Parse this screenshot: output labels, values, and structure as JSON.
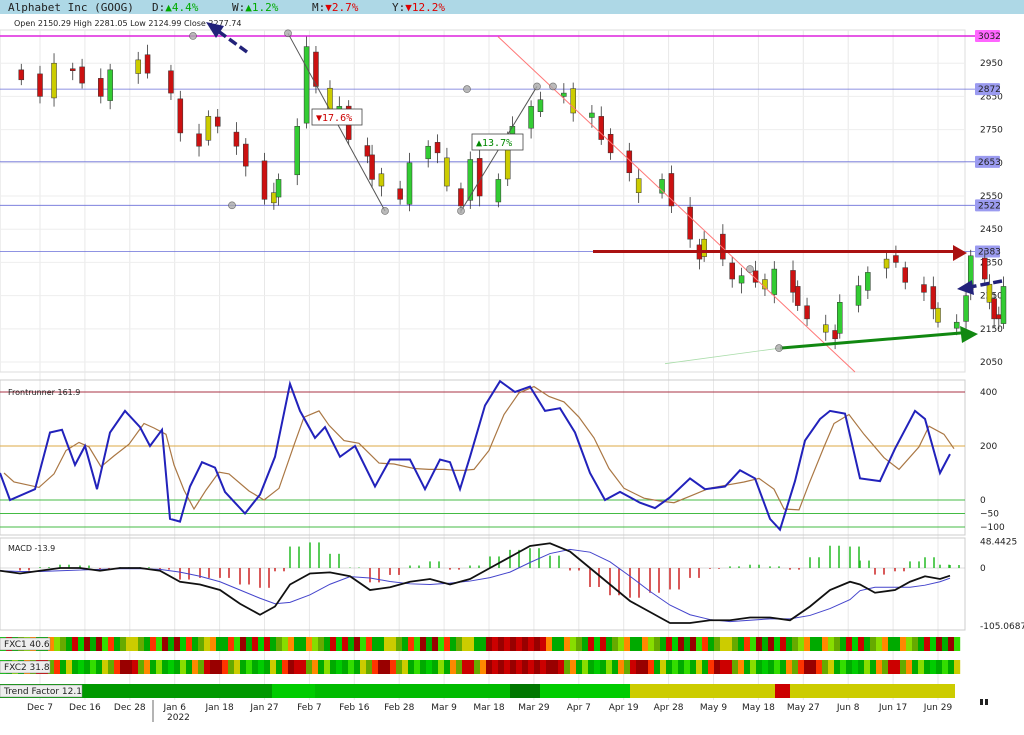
{
  "header": {
    "title": "Alphabet Inc (GOOG)",
    "changes": [
      {
        "label": "D:",
        "dir": "up",
        "value": "4.4%"
      },
      {
        "label": "W:",
        "dir": "up",
        "value": "1.2%"
      },
      {
        "label": "M:",
        "dir": "down",
        "value": "2.7%"
      },
      {
        "label": "Y:",
        "dir": "down",
        "value": "12.2%"
      }
    ],
    "ohlc": "Open 2150.29  High 2281.05  Low 2124.99  Close 2277.74"
  },
  "price_panel": {
    "y_ticks": [
      2050,
      2150,
      2250,
      2350,
      2450,
      2550,
      2650,
      2750,
      2850,
      2950
    ],
    "levels": [
      {
        "value": 3032,
        "label": "3032",
        "color": "#dd22dd"
      },
      {
        "value": 2872,
        "label": "2872",
        "color": "#6a6fd8"
      },
      {
        "value": 2653,
        "label": "2653",
        "color": "#6a6fd8"
      },
      {
        "value": 2522,
        "label": "2522",
        "color": "#6a6fd8"
      },
      {
        "value": 2383,
        "label": "2383",
        "color": "#6a6fd8"
      }
    ],
    "annotations": [
      {
        "text": "▼17.6%",
        "color": "#cc0000"
      },
      {
        "text": "▲13.7%",
        "color": "#008800"
      }
    ]
  },
  "frontrunner": {
    "label": "Frontrunner 161.9",
    "y_ticks": [
      "400",
      "200",
      "0",
      "−50",
      "−100"
    ]
  },
  "macd": {
    "label": "MACD -13.9",
    "y_ticks": [
      "48.4425",
      "0",
      "-105.0687"
    ]
  },
  "bands": [
    {
      "label": "FXC1 40.6"
    },
    {
      "label": "FXC2 31.8"
    },
    {
      "label": "Trend Factor 12.1"
    }
  ],
  "x_axis": {
    "ticks": [
      "Dec 7",
      "Dec 16",
      "Dec 28",
      "Jan 6",
      "Jan 18",
      "Jan 27",
      "Feb 7",
      "Feb 16",
      "Feb 28",
      "Mar 9",
      "Mar 18",
      "Mar 29",
      "Apr 7",
      "Apr 19",
      "Apr 28",
      "May 9",
      "May 18",
      "May 27",
      "Jun 8",
      "Jun 17",
      "Jun 29"
    ],
    "year": "2022"
  },
  "chart_data": {
    "type": "candlestick",
    "title": "Alphabet Inc (GOOG)",
    "ylim": [
      2020,
      3050
    ],
    "price_close_path": [
      [
        "Dec 3",
        2900
      ],
      [
        "Dec 7",
        2850
      ],
      [
        "Dec 10",
        2950
      ],
      [
        "Dec 14",
        2930
      ],
      [
        "Dec 16",
        2890
      ],
      [
        "Dec 20",
        2850
      ],
      [
        "Dec 22",
        2930
      ],
      [
        "Dec 28",
        2960
      ],
      [
        "Dec 30",
        2920
      ],
      [
        "Jan 4",
        2860
      ],
      [
        "Jan 6",
        2740
      ],
      [
        "Jan 10",
        2700
      ],
      [
        "Jan 12",
        2790
      ],
      [
        "Jan 14",
        2760
      ],
      [
        "Jan 18",
        2700
      ],
      [
        "Jan 20",
        2640
      ],
      [
        "Jan 24",
        2540
      ],
      [
        "Jan 26",
        2560
      ],
      [
        "Jan 27",
        2600
      ],
      [
        "Jan 31",
        2760
      ],
      [
        "Feb 2",
        3000
      ],
      [
        "Feb 4",
        2880
      ],
      [
        "Feb 7",
        2790
      ],
      [
        "Feb 9",
        2820
      ],
      [
        "Feb 11",
        2720
      ],
      [
        "Feb 15",
        2670
      ],
      [
        "Feb 16",
        2600
      ],
      [
        "Feb 18",
        2580
      ],
      [
        "Feb 22",
        2540
      ],
      [
        "Feb 24",
        2650
      ],
      [
        "Feb 28",
        2700
      ],
      [
        "Mar 2",
        2680
      ],
      [
        "Mar 4",
        2580
      ],
      [
        "Mar 7",
        2520
      ],
      [
        "Mar 9",
        2660
      ],
      [
        "Mar 11",
        2550
      ],
      [
        "Mar 15",
        2600
      ],
      [
        "Mar 17",
        2720
      ],
      [
        "Mar 18",
        2760
      ],
      [
        "Mar 22",
        2820
      ],
      [
        "Mar 24",
        2840
      ],
      [
        "Mar 29",
        2860
      ],
      [
        "Mar 31",
        2800
      ],
      [
        "Apr 4",
        2800
      ],
      [
        "Apr 6",
        2720
      ],
      [
        "Apr 8",
        2680
      ],
      [
        "Apr 12",
        2620
      ],
      [
        "Apr 14",
        2560
      ],
      [
        "Apr 19",
        2600
      ],
      [
        "Apr 21",
        2520
      ],
      [
        "Apr 25",
        2420
      ],
      [
        "Apr 27",
        2360
      ],
      [
        "Apr 28",
        2420
      ],
      [
        "May 2",
        2360
      ],
      [
        "May 4",
        2300
      ],
      [
        "May 6",
        2310
      ],
      [
        "May 9",
        2290
      ],
      [
        "May 11",
        2270
      ],
      [
        "May 13",
        2330
      ],
      [
        "May 17",
        2260
      ],
      [
        "May 18",
        2220
      ],
      [
        "May 20",
        2180
      ],
      [
        "May 24",
        2140
      ],
      [
        "May 26",
        2120
      ],
      [
        "May 27",
        2230
      ],
      [
        "May 31",
        2280
      ],
      [
        "Jun 2",
        2320
      ],
      [
        "Jun 6",
        2360
      ],
      [
        "Jun 8",
        2350
      ],
      [
        "Jun 10",
        2290
      ],
      [
        "Jun 14",
        2260
      ],
      [
        "Jun 16",
        2210
      ],
      [
        "Jun 17",
        2170
      ],
      [
        "Jun 21",
        2170
      ],
      [
        "Jun 23",
        2250
      ],
      [
        "Jun 24",
        2370
      ],
      [
        "Jun 27",
        2300
      ],
      [
        "Jun 28",
        2230
      ],
      [
        "Jun 29",
        2180
      ],
      [
        "Jun 30",
        2180
      ],
      [
        "Jul 1",
        2277.74
      ]
    ],
    "series": [
      {
        "name": "Frontrunner",
        "values": []
      },
      {
        "name": "MACD",
        "values": []
      }
    ]
  },
  "style": {
    "up_color": "#33cc33",
    "down_color": "#cc1111",
    "neutral_color": "#cccc00",
    "line_blue": "#2222bb",
    "line_brown": "#aa7744",
    "header_bg": "#aed8e6"
  }
}
